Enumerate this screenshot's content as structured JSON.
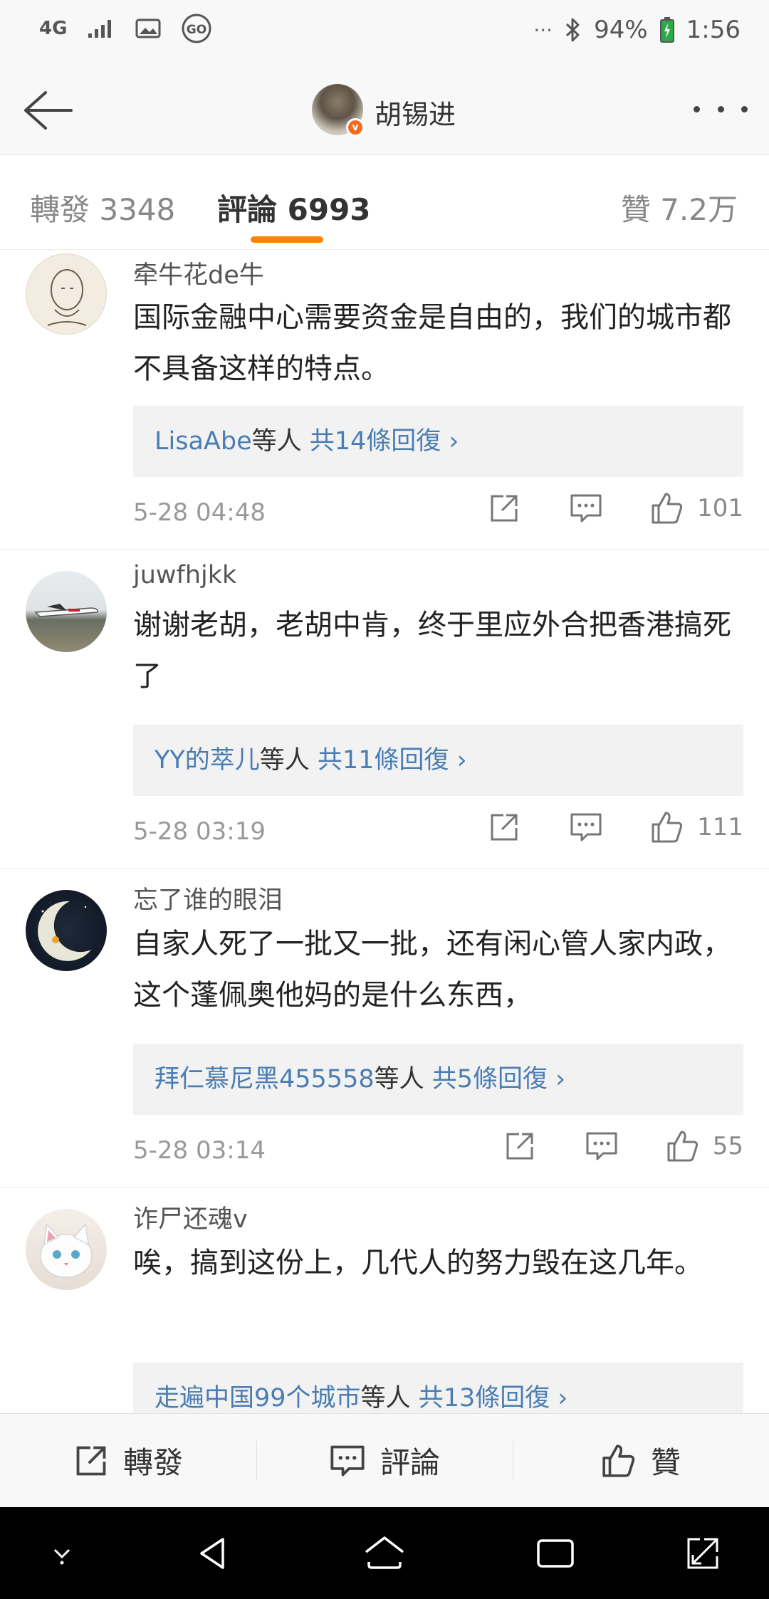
{
  "status_bar": {
    "network": "4G",
    "battery": "94%",
    "time": "1:56",
    "more": "···"
  },
  "header": {
    "title": "胡锡进"
  },
  "tabs": {
    "repost": "轉發 3348",
    "comment": "評論 6993",
    "like": "贊 7.2万"
  },
  "comments": [
    {
      "user": "牵牛花de牛",
      "text": "国际金融中心需要资金是自由的，我们的城市都不具备这样的特点。",
      "reply_users": "LisaAbe",
      "reply_suffix": "等人",
      "reply_count": " 共14條回復 ›",
      "time": "5-28 04:48",
      "likes": "101"
    },
    {
      "user": "juwfhjkk",
      "text": "谢谢老胡，老胡中肯，终于里应外合把香港搞死了",
      "reply_users": "YY的萃儿",
      "reply_suffix": "等人",
      "reply_count": " 共11條回復 ›",
      "time": "5-28 03:19",
      "likes": "111"
    },
    {
      "user": "忘了谁的眼泪",
      "text": "自家人死了一批又一批，还有闲心管人家内政，这个蓬佩奥他妈的是什么东西，",
      "reply_users": "拜仁慕尼黑455558",
      "reply_suffix": "等人",
      "reply_count": " 共5條回復 ›",
      "time": "5-28 03:14",
      "likes": "55"
    },
    {
      "user": "诈尸还魂v",
      "text": "唉，搞到这份上，几代人的努力毁在这几年。",
      "reply_users": "走遍中国99个城市",
      "reply_suffix": "等人",
      "reply_count": " 共13條回復 ›"
    }
  ],
  "bottom_bar": {
    "repost": "轉發",
    "comment": "評論",
    "like": "贊"
  }
}
